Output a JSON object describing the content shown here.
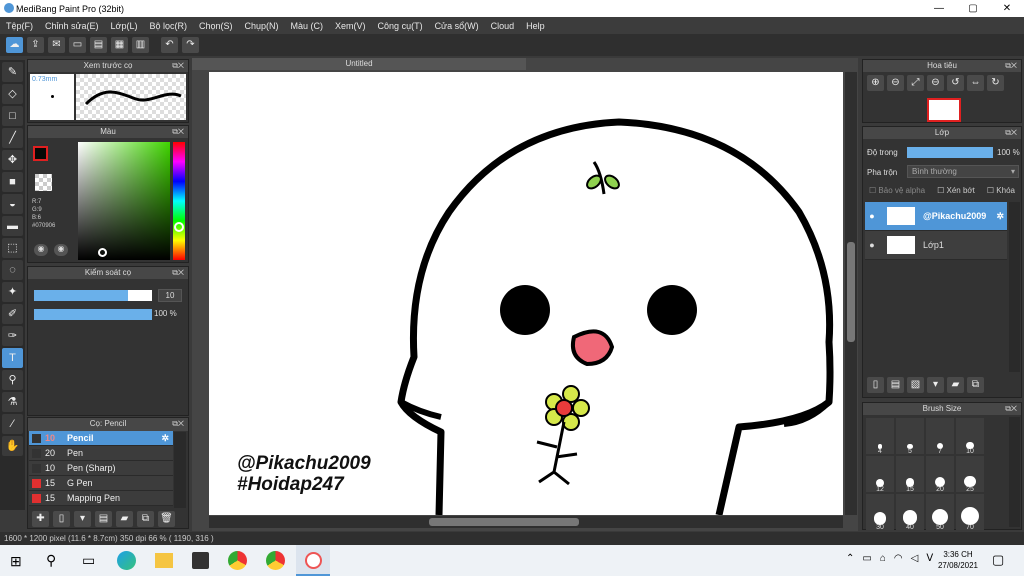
{
  "app": {
    "title": "MediBang Paint Pro (32bit)",
    "min": "—",
    "max": "▢",
    "close": "✕"
  },
  "menu": [
    "Tệp(F)",
    "Chỉnh sửa(E)",
    "Lớp(L)",
    "Bộ lọc(R)",
    "Chọn(S)",
    "Chụp(N)",
    "Màu (C)",
    "Xem(V)",
    "Công cụ(T)",
    "Cửa sổ(W)",
    "Cloud",
    "Help"
  ],
  "brushPreview": {
    "title": "Xem trước cọ",
    "size": "0.73mm"
  },
  "color": {
    "title": "Màu",
    "r": "R:7",
    "g": "G:9",
    "b": "B:6",
    "hex": "#070906",
    "current": "#070906"
  },
  "brushControl": {
    "title": "Kiểm soát cọ",
    "size": "10",
    "opacity": "100 %",
    "size_fraction": 0.8,
    "opacity_fraction": 1.0
  },
  "brushList": {
    "title": "Cọ: Pencil",
    "items": [
      {
        "size": "10",
        "name": "Pencil",
        "color": "#333333",
        "selected": true
      },
      {
        "size": "20",
        "name": "Pen",
        "color": "#333333",
        "selected": false
      },
      {
        "size": "10",
        "name": "Pen (Sharp)",
        "color": "#333333",
        "selected": false
      },
      {
        "size": "15",
        "name": "G Pen",
        "color": "#e03030",
        "selected": false
      },
      {
        "size": "15",
        "name": "Mapping Pen",
        "color": "#e03030",
        "selected": false
      }
    ]
  },
  "canvas": {
    "tab": "Untitled",
    "text1": "@Pikachu2009",
    "text2": "#Hoidap247"
  },
  "navigator": {
    "title": "Hoa tiêu"
  },
  "layers": {
    "title": "Lớp",
    "opacity_label": "Độ trong",
    "opacity": "100 %",
    "opacity_fraction": 1.0,
    "blend_label": "Pha trộn",
    "blend": "Bình thường",
    "protect": "Bảo vệ alpha",
    "clip": "Xén bớt",
    "lock": "Khóa",
    "items": [
      {
        "name": "@Pikachu2009",
        "selected": true
      },
      {
        "name": "Lớp1",
        "selected": false
      }
    ]
  },
  "brushSize": {
    "title": "Brush Size",
    "sizes": [
      "4",
      "5",
      "7",
      "10",
      "12",
      "15",
      "20",
      "25",
      "30",
      "40",
      "50",
      "70"
    ]
  },
  "status": {
    "text": "1600 * 1200 pixel   (11.6 * 8.7cm)   350 dpi   66 %   ( 1190, 316 )"
  },
  "taskbar": {
    "time": "3:36 CH",
    "date": "27/08/2021"
  }
}
